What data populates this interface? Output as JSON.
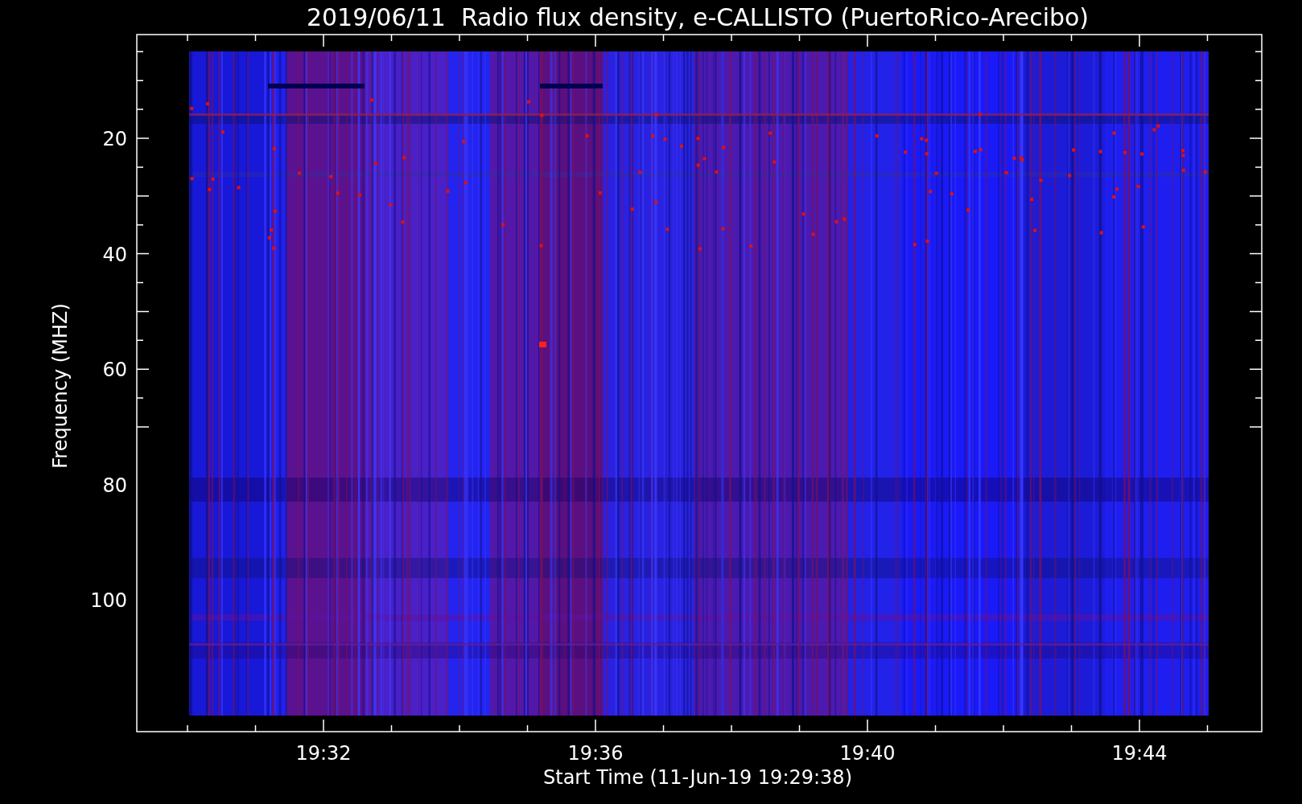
{
  "title": "2019/06/11  Radio flux density, e-CALLISTO (PuertoRico-Arecibo)",
  "y_axis": {
    "label": "Frequency (MHZ)",
    "ticks": [
      "20",
      "40",
      "60",
      "80",
      "100"
    ]
  },
  "x_axis": {
    "label": "Start Time (11-Jun-19 19:29:38)",
    "ticks": [
      "19:32",
      "19:36",
      "19:40",
      "19:44"
    ]
  }
}
